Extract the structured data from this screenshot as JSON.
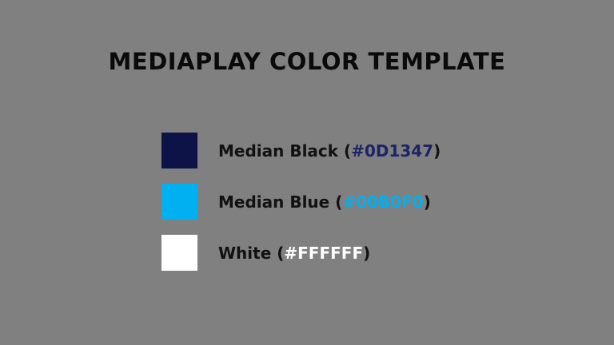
{
  "title": "MEDIAPLAY COLOR TEMPLATE",
  "colors": [
    {
      "name": "Median Black",
      "open": " (",
      "hex": "#0D1347",
      "close": ")",
      "swatch_color": "#0D1347",
      "hex_text_color": "#1c2466"
    },
    {
      "name": "Median Blue",
      "open": " (",
      "hex": "#00B0F0",
      "close": ")",
      "swatch_color": "#00B0F0",
      "hex_text_color": "#00B0F0"
    },
    {
      "name": "White",
      "open": " (",
      "hex": "#FFFFFF",
      "close": ")",
      "swatch_color": "#FFFFFF",
      "hex_text_color": "#FFFFFF"
    }
  ]
}
